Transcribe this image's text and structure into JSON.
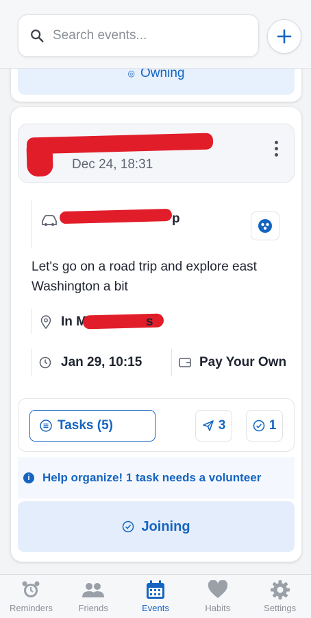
{
  "search": {
    "placeholder": "Search events..."
  },
  "previous_card": {
    "status_label": "Owning"
  },
  "event": {
    "date": "Dec 24, 18:31",
    "title_suffix": "p",
    "description": "Let's go on a road trip and explore east Washington a bit",
    "location_prefix": "In M",
    "location_suffix": "s",
    "start": "Jan 29, 10:15",
    "payment": "Pay Your Own",
    "tasks_label": "Tasks (5)",
    "invites_count": "3",
    "done_count": "1",
    "help_text": "Help organize! 1 task needs a volunteer",
    "status_label": "Joining"
  },
  "nav": [
    {
      "label": "Reminders",
      "icon": "alarm-clock-icon"
    },
    {
      "label": "Friends",
      "icon": "people-icon"
    },
    {
      "label": "Events",
      "icon": "calendar-icon",
      "active": true
    },
    {
      "label": "Habits",
      "icon": "heart-icon"
    },
    {
      "label": "Settings",
      "icon": "gear-icon"
    }
  ],
  "colors": {
    "accent": "#1565c0",
    "status_bg": "#e3edfc",
    "redaction": "#e11d2a"
  }
}
